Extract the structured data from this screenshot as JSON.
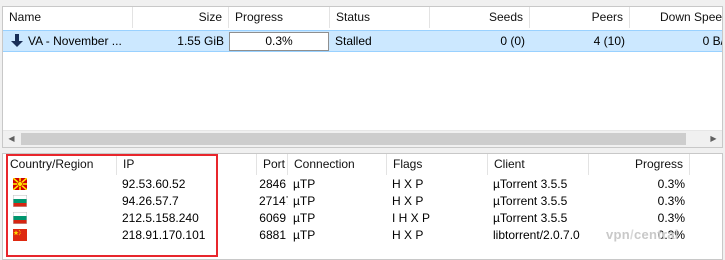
{
  "torrent_list": {
    "columns": {
      "name": "Name",
      "size": "Size",
      "progress": "Progress",
      "status": "Status",
      "seeds": "Seeds",
      "peers": "Peers",
      "down_speed": "Down Speed"
    },
    "rows": [
      {
        "name": "VA - November ...",
        "size": "1.55 GiB",
        "progress": "0.3%",
        "status": "Stalled",
        "seeds": "0 (0)",
        "peers": "4 (10)",
        "down_speed": "0 B/"
      }
    ]
  },
  "peers_list": {
    "columns": {
      "country": "Country/Region",
      "ip": "IP",
      "port": "Port",
      "connection": "Connection",
      "flags": "Flags",
      "client": "Client",
      "progress": "Progress"
    },
    "rows": [
      {
        "flag_icon": "north-macedonia-flag-icon",
        "ip": "92.53.60.52",
        "port": "2846",
        "connection": "µTP",
        "flags": "H X P",
        "client": "µTorrent 3.5.5",
        "progress": "0.3%"
      },
      {
        "flag_icon": "bulgaria-flag-icon",
        "ip": "94.26.57.7",
        "port": "27147",
        "connection": "µTP",
        "flags": "H X P",
        "client": "µTorrent 3.5.5",
        "progress": "0.3%"
      },
      {
        "flag_icon": "bulgaria-flag-icon",
        "ip": "212.5.158.240",
        "port": "6069",
        "connection": "µTP",
        "flags": "I H X P",
        "client": "µTorrent 3.5.5",
        "progress": "0.3%"
      },
      {
        "flag_icon": "china-flag-icon",
        "ip": "218.91.170.101",
        "port": "6881",
        "connection": "µTP",
        "flags": "H X P",
        "client": "libtorrent/2.0.7.0",
        "progress": "0.3%"
      }
    ]
  },
  "watermark": {
    "part1": "vpn",
    "part2": "central"
  },
  "colors": {
    "selection": "#cce8ff",
    "highlight_border": "#e8262c"
  }
}
